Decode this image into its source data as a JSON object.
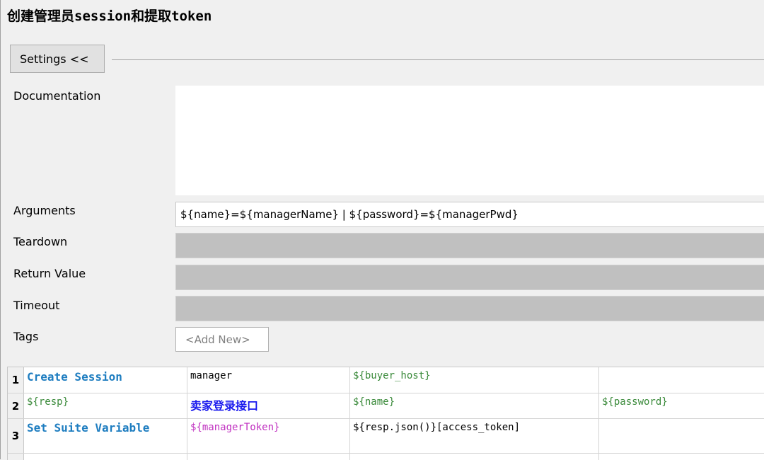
{
  "header": {
    "title": "创建管理员session和提取token"
  },
  "settings": {
    "toggle_label": "Settings <<"
  },
  "fields": {
    "documentation_label": "Documentation",
    "documentation_value": "",
    "arguments_label": "Arguments",
    "arguments_value": "${name}=${managerName} | ${password}=${managerPwd}",
    "teardown_label": "Teardown",
    "return_value_label": "Return Value",
    "timeout_label": "Timeout",
    "tags_label": "Tags",
    "tags_add_new": "<Add New>"
  },
  "grid": {
    "rows": [
      {
        "num": "1",
        "cells": [
          "Create Session",
          "manager",
          "${buyer_host}",
          ""
        ]
      },
      {
        "num": "2",
        "cells": [
          "${resp}",
          "卖家登录接口",
          "${name}",
          "${password}"
        ]
      },
      {
        "num": "3",
        "cells": [
          "Set Suite Variable",
          "${managerToken}",
          "${resp.json()}[access_token]",
          ""
        ]
      }
    ]
  }
}
